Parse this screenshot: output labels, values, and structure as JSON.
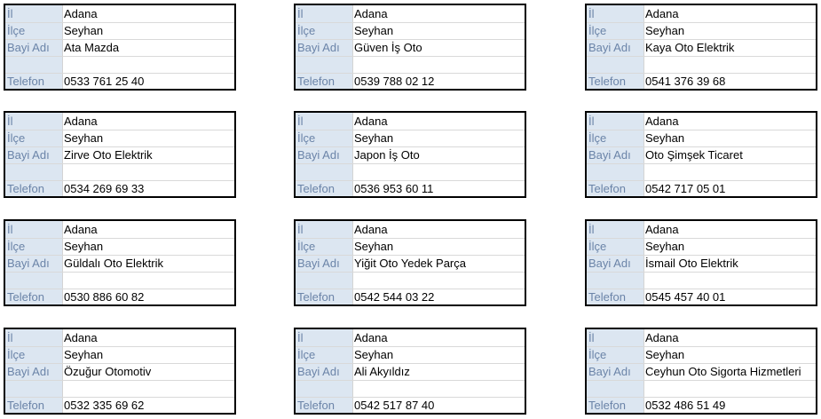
{
  "labels": {
    "il": "İl",
    "ilce": "İlçe",
    "bayi_adi": "Bayi Adı",
    "telefon": "Telefon"
  },
  "cards": [
    {
      "il": "Adana",
      "ilce": "Seyhan",
      "bayi_adi": "Ata Mazda",
      "telefon": "0533 761 25 40"
    },
    {
      "il": "Adana",
      "ilce": "Seyhan",
      "bayi_adi": "Güven İş Oto",
      "telefon": "0539 788 02 12"
    },
    {
      "il": "Adana",
      "ilce": "Seyhan",
      "bayi_adi": "Kaya Oto Elektrik",
      "telefon": "0541 376 39 68"
    },
    {
      "il": "Adana",
      "ilce": "Seyhan",
      "bayi_adi": "Zirve Oto Elektrik",
      "telefon": "0534 269 69 33"
    },
    {
      "il": "Adana",
      "ilce": "Seyhan",
      "bayi_adi": "Japon İş Oto",
      "telefon": "0536 953 60 11"
    },
    {
      "il": "Adana",
      "ilce": "Seyhan",
      "bayi_adi": "Oto Şimşek Ticaret",
      "telefon": "0542 717 05 01"
    },
    {
      "il": "Adana",
      "ilce": "Seyhan",
      "bayi_adi": "Güldalı Oto Elektrik",
      "telefon": "0530 886 60 82"
    },
    {
      "il": "Adana",
      "ilce": "Seyhan",
      "bayi_adi": "Yiğit Oto Yedek Parça",
      "telefon": "0542 544 03 22"
    },
    {
      "il": "Adana",
      "ilce": "Seyhan",
      "bayi_adi": "İsmail Oto Elektrik",
      "telefon": "0545 457 40 01"
    },
    {
      "il": "Adana",
      "ilce": "Seyhan",
      "bayi_adi": "Özuğur Otomotiv",
      "telefon": "0532 335 69 62"
    },
    {
      "il": "Adana",
      "ilce": "Seyhan",
      "bayi_adi": "Ali Akyıldız",
      "telefon": "0542 517 87 40"
    },
    {
      "il": "Adana",
      "ilce": "Seyhan",
      "bayi_adi": "Ceyhun Oto Sigorta Hizmetleri",
      "telefon": "0532 486 51 49"
    }
  ]
}
